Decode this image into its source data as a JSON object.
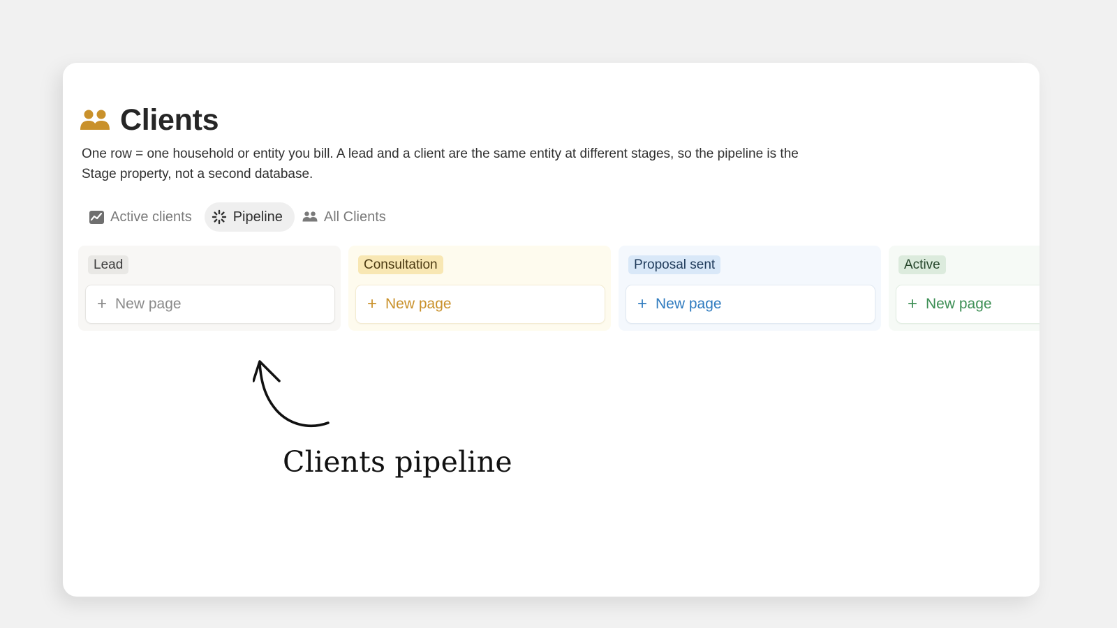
{
  "page": {
    "title": "Clients",
    "title_icon": "people-icon",
    "description": "One row = one household or entity you bill. A lead and a client are the same entity at different stages, so the pipeline is the Stage property, not a second database."
  },
  "tabs": [
    {
      "label": "Active clients",
      "icon": "chart-icon",
      "active": false
    },
    {
      "label": "Pipeline",
      "icon": "loading-icon",
      "active": true
    },
    {
      "label": "All Clients",
      "icon": "people-icon",
      "active": false
    }
  ],
  "columns": [
    {
      "name": "Lead",
      "new_page_label": "New page",
      "bg": "#f8f7f5",
      "badge_bg": "#e9e8e5",
      "badge_color": "#3a3a3a",
      "accent": "#8a8a8a",
      "card_border": "#e6e5e2"
    },
    {
      "name": "Consultation",
      "new_page_label": "New page",
      "bg": "#fefbee",
      "badge_bg": "#f8e7b3",
      "badge_color": "#4b3a12",
      "accent": "#c9912b",
      "card_border": "#f3ebd1"
    },
    {
      "name": "Proposal sent",
      "new_page_label": "New page",
      "bg": "#f4f8fd",
      "badge_bg": "#d9e8f8",
      "badge_color": "#1e3a5a",
      "accent": "#2f7bbf",
      "card_border": "#e1e9f2"
    },
    {
      "name": "Active",
      "new_page_label": "New page",
      "bg": "#f6faf6",
      "badge_bg": "#dcebdd",
      "badge_color": "#24452a",
      "accent": "#3d8f55",
      "card_border": "#e2eee3"
    }
  ],
  "annotation": {
    "text": "Clients pipeline",
    "arrow_icon": "curved-arrow-icon"
  },
  "colors": {
    "title_icon": "#c9912b",
    "background": "#f1f1f1",
    "card": "#ffffff"
  }
}
